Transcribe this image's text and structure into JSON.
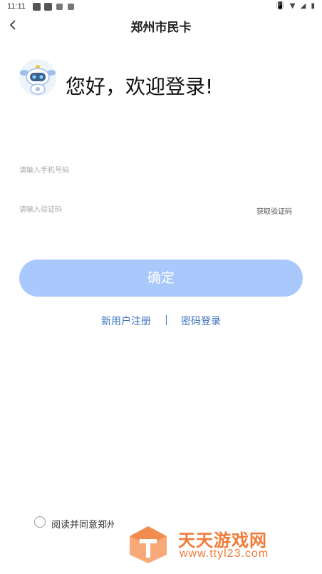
{
  "status_bar": {
    "time": "11:11",
    "right_icons": "📳 ▼ ◢ ▮"
  },
  "nav": {
    "back_icon": "chevron-left-icon",
    "title": "郑州市民卡"
  },
  "welcome": {
    "mascot_icon": "robot-mascot-icon",
    "text": "您好，欢迎登录!"
  },
  "phone_field": {
    "placeholder": "请输入手机号码",
    "value": ""
  },
  "code_field": {
    "placeholder": "请输入验证码",
    "value": "",
    "get_code_label": "获取验证码"
  },
  "confirm_label": "确定",
  "links": {
    "register": "新用户注册",
    "password_login": "密码登录"
  },
  "agreement": {
    "text": "阅读并同意郑州",
    "checked": false
  },
  "watermark": {
    "title": "天天游戏网",
    "url": "www.ttyl23.com"
  },
  "colors": {
    "button_bg": "#a9c8fb",
    "link": "#3a6fc4",
    "watermark": "#f07b39"
  }
}
